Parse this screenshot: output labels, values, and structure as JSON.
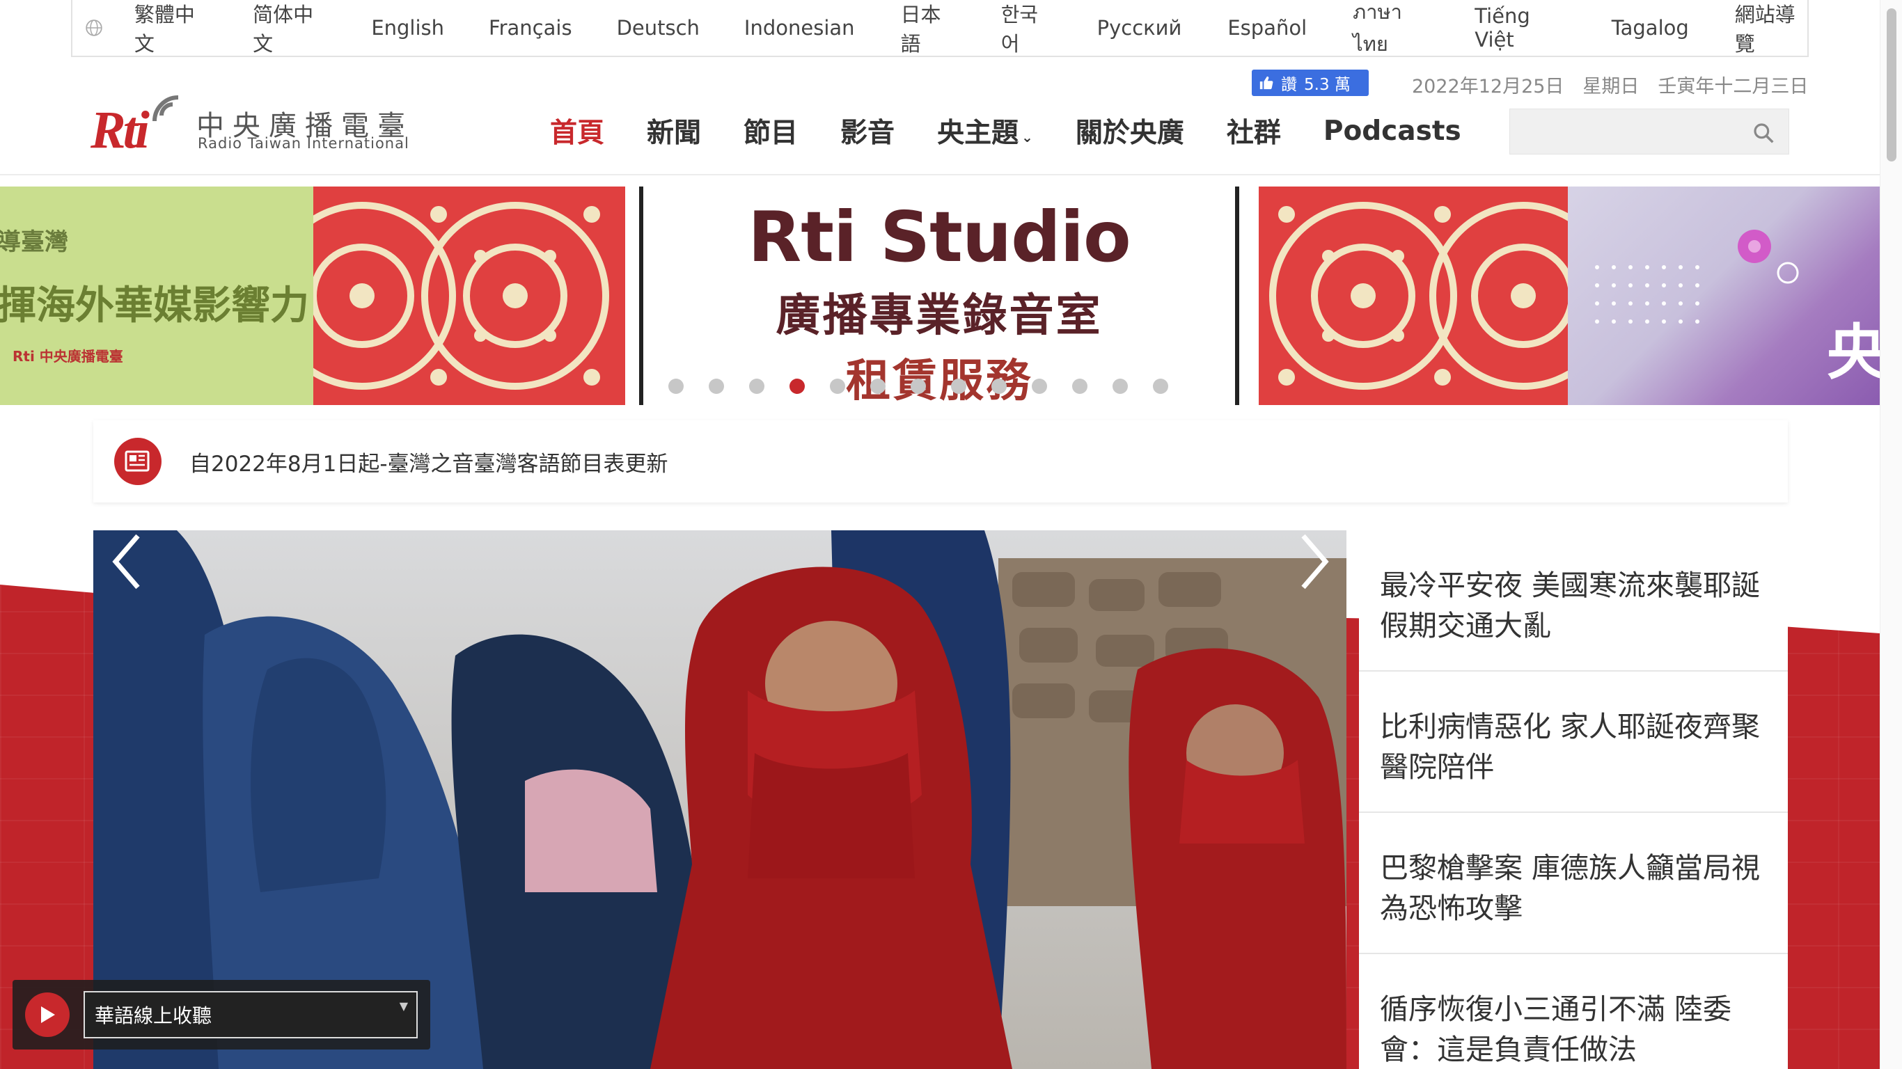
{
  "languages": [
    "繁體中文",
    "简体中文",
    "English",
    "Français",
    "Deutsch",
    "Indonesian",
    "日本語",
    "한국어",
    "Русский",
    "Español",
    "ภาษาไทย",
    "Tiếng Việt",
    "Tagalog",
    "網站導覽"
  ],
  "logo": {
    "mark": "Rti",
    "chinese_name": "中央廣播電臺",
    "english_name": "Radio Taiwan International"
  },
  "facebook": {
    "label": "讚",
    "count": "5.3 萬"
  },
  "date_text": "2022年12月25日　星期日　壬寅年十二月三日",
  "nav": [
    "首頁",
    "新聞",
    "節目",
    "影音",
    "央主題",
    "關於央廣",
    "社群",
    "Podcasts"
  ],
  "search": {
    "placeholder": ""
  },
  "banner": {
    "left_line1": "導臺灣",
    "left_line2": "揮海外華媒影響力",
    "left_logo": "Rti 中央廣播電臺",
    "studio_title": "Rti Studio",
    "studio_sub": "廣播專業錄音室",
    "studio_sub2": "租賃服務",
    "right_char": "央",
    "dot_count": 13,
    "active_dot": 3
  },
  "announcement": "自2022年8月1日起-臺灣之音臺灣客語節目表更新",
  "news": [
    "最冷平安夜 美國寒流來襲耶誕假期交通大亂",
    "比利病情惡化 家人耶誕夜齊聚醫院陪伴",
    "巴黎槍擊案 庫德族人籲當局視為恐怖攻擊",
    "循序恢復小三通引不滿 陸委會：這是負責任做法"
  ],
  "player": {
    "selected": "華語線上收聽"
  },
  "colors": {
    "brand_red": "#c8282c",
    "nav_text": "#333333",
    "fb_blue": "#3b6ee0"
  }
}
